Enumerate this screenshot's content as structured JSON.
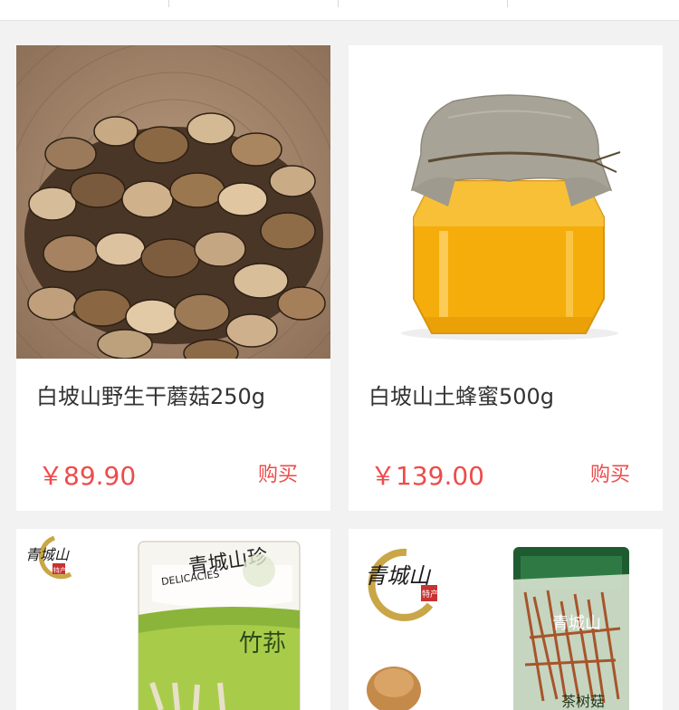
{
  "products": [
    {
      "title": "白坡山野生干蘑菇250g",
      "price": "￥89.90",
      "buy_label": "购买"
    },
    {
      "title": "白坡山土蜂蜜500g",
      "price": "￥139.00",
      "buy_label": "购买"
    },
    {
      "brand": "青城山",
      "seal": "特产",
      "package_brand": "青城山珍",
      "package_subtitle": "DELICACIES",
      "package_product": "竹荪"
    },
    {
      "brand": "青城山",
      "seal": "特产",
      "package_brand": "青城山",
      "package_product": "茶树菇"
    }
  ],
  "colors": {
    "price": "#ee4b4b",
    "background": "#f2f2f2",
    "card": "#ffffff"
  }
}
